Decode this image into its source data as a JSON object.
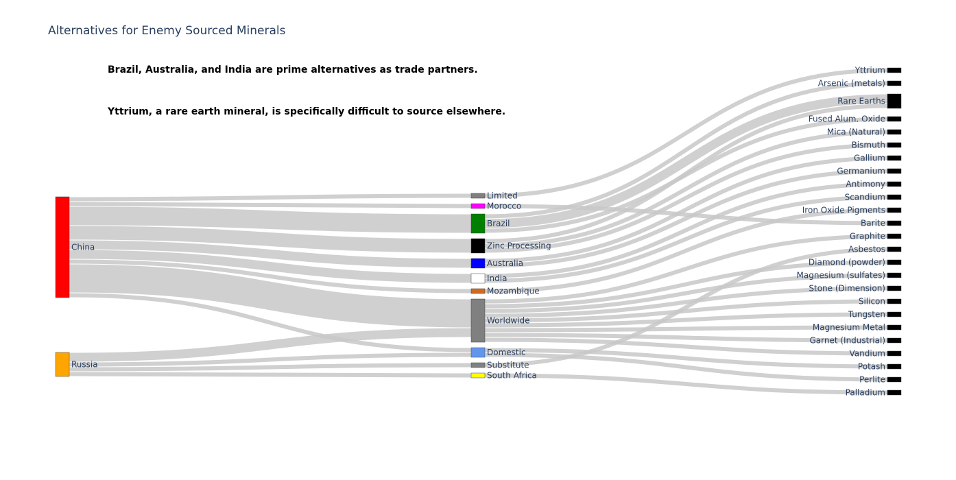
{
  "title": "Alternatives for Enemy Sourced Minerals",
  "annotations": [
    "Brazil, Australia, and India are prime alternatives as trade partners.",
    "Yttrium, a rare earth mineral, is specifically difficult to source elsewhere."
  ],
  "chart_data": {
    "type": "sankey",
    "title": "Alternatives for Enemy Sourced Minerals",
    "link_color": "#c8c8c8",
    "nodes": [
      {
        "id": "China",
        "label": "China",
        "column": 0,
        "color": "#ff0000"
      },
      {
        "id": "Russia",
        "label": "Russia",
        "column": 0,
        "color": "#ffa500"
      },
      {
        "id": "Limited",
        "label": "Limited",
        "column": 1,
        "color": "#808080"
      },
      {
        "id": "Morocco",
        "label": "Morocco",
        "column": 1,
        "color": "#ff00ff"
      },
      {
        "id": "Brazil",
        "label": "Brazil",
        "column": 1,
        "color": "#008000"
      },
      {
        "id": "Zinc Processing",
        "label": "Zinc Processing",
        "column": 1,
        "color": "#000000"
      },
      {
        "id": "Australia",
        "label": "Australia",
        "column": 1,
        "color": "#0000ff"
      },
      {
        "id": "India",
        "label": "India",
        "column": 1,
        "color": "#ffffff"
      },
      {
        "id": "Mozambique",
        "label": "Mozambique",
        "column": 1,
        "color": "#d2691e"
      },
      {
        "id": "Worldwide",
        "label": "Worldwide",
        "column": 1,
        "color": "#808080"
      },
      {
        "id": "Domestic",
        "label": "Domestic",
        "column": 1,
        "color": "#6495ed"
      },
      {
        "id": "Substitute",
        "label": "Substitute",
        "column": 1,
        "color": "#808080"
      },
      {
        "id": "South Africa",
        "label": "South Africa",
        "column": 1,
        "color": "#ffff00"
      },
      {
        "id": "Yttrium",
        "label": "Yttrium",
        "column": 2,
        "color": "#000000"
      },
      {
        "id": "Arsenic (metals)",
        "label": "Arsenic (metals)",
        "column": 2,
        "color": "#000000"
      },
      {
        "id": "Rare Earths",
        "label": "Rare Earths",
        "column": 2,
        "color": "#000000"
      },
      {
        "id": "Fused Alum. Oxide",
        "label": "Fused Alum. Oxide",
        "column": 2,
        "color": "#000000"
      },
      {
        "id": "Mica (Natural)",
        "label": "Mica (Natural)",
        "column": 2,
        "color": "#000000"
      },
      {
        "id": "Bismuth",
        "label": "Bismuth",
        "column": 2,
        "color": "#000000"
      },
      {
        "id": "Gallium",
        "label": "Gallium",
        "column": 2,
        "color": "#000000"
      },
      {
        "id": "Germanium",
        "label": "Germanium",
        "column": 2,
        "color": "#000000"
      },
      {
        "id": "Antimony",
        "label": "Antimony",
        "column": 2,
        "color": "#000000"
      },
      {
        "id": "Scandium",
        "label": "Scandium",
        "column": 2,
        "color": "#000000"
      },
      {
        "id": "Iron Oxide Pigments",
        "label": "Iron Oxide Pigments",
        "column": 2,
        "color": "#000000"
      },
      {
        "id": "Barite",
        "label": "Barite",
        "column": 2,
        "color": "#000000"
      },
      {
        "id": "Graphite",
        "label": "Graphite",
        "column": 2,
        "color": "#000000"
      },
      {
        "id": "Asbestos",
        "label": "Asbestos",
        "column": 2,
        "color": "#000000"
      },
      {
        "id": "Diamond (powder)",
        "label": "Diamond (powder)",
        "column": 2,
        "color": "#000000"
      },
      {
        "id": "Magnesium (sulfates)",
        "label": "Magnesium (sulfates)",
        "column": 2,
        "color": "#000000"
      },
      {
        "id": "Stone (Dimension)",
        "label": "Stone (Dimension)",
        "column": 2,
        "color": "#000000"
      },
      {
        "id": "Silicon",
        "label": "Silicon",
        "column": 2,
        "color": "#000000"
      },
      {
        "id": "Tungsten",
        "label": "Tungsten",
        "column": 2,
        "color": "#000000"
      },
      {
        "id": "Magnesium Metal",
        "label": "Magnesium Metal",
        "column": 2,
        "color": "#000000"
      },
      {
        "id": "Garnet (Industrial)",
        "label": "Garnet (Industrial)",
        "column": 2,
        "color": "#000000"
      },
      {
        "id": "Vandium",
        "label": "Vandium",
        "column": 2,
        "color": "#000000"
      },
      {
        "id": "Potash",
        "label": "Potash",
        "column": 2,
        "color": "#000000"
      },
      {
        "id": "Perlite",
        "label": "Perlite",
        "column": 2,
        "color": "#000000"
      },
      {
        "id": "Palladium",
        "label": "Palladium",
        "column": 2,
        "color": "#000000"
      }
    ],
    "links": [
      {
        "source": "China",
        "target": "Limited",
        "value": 1
      },
      {
        "source": "China",
        "target": "Morocco",
        "value": 1
      },
      {
        "source": "China",
        "target": "Brazil",
        "value": 4
      },
      {
        "source": "China",
        "target": "Zinc Processing",
        "value": 3
      },
      {
        "source": "China",
        "target": "Australia",
        "value": 2
      },
      {
        "source": "China",
        "target": "India",
        "value": 2
      },
      {
        "source": "China",
        "target": "Mozambique",
        "value": 1
      },
      {
        "source": "China",
        "target": "Worldwide",
        "value": 6
      },
      {
        "source": "China",
        "target": "Domestic",
        "value": 1
      },
      {
        "source": "Russia",
        "target": "Worldwide",
        "value": 2
      },
      {
        "source": "Russia",
        "target": "Domestic",
        "value": 1
      },
      {
        "source": "Russia",
        "target": "Substitute",
        "value": 1
      },
      {
        "source": "Russia",
        "target": "South Africa",
        "value": 1
      },
      {
        "source": "Limited",
        "target": "Yttrium",
        "value": 1
      },
      {
        "source": "Brazil",
        "target": "Arsenic (metals)",
        "value": 1
      },
      {
        "source": "Brazil",
        "target": "Rare Earths",
        "value": 2
      },
      {
        "source": "Zinc Processing",
        "target": "Rare Earths",
        "value": 1
      },
      {
        "source": "Brazil",
        "target": "Fused Alum. Oxide",
        "value": 1
      },
      {
        "source": "Zinc Processing",
        "target": "Mica (Natural)",
        "value": 1
      },
      {
        "source": "Zinc Processing",
        "target": "Bismuth",
        "value": 1
      },
      {
        "source": "Australia",
        "target": "Gallium",
        "value": 1
      },
      {
        "source": "Australia",
        "target": "Germanium",
        "value": 1
      },
      {
        "source": "India",
        "target": "Antimony",
        "value": 1
      },
      {
        "source": "India",
        "target": "Scandium",
        "value": 1
      },
      {
        "source": "Mozambique",
        "target": "Iron Oxide Pigments",
        "value": 1
      },
      {
        "source": "Morocco",
        "target": "Barite",
        "value": 1
      },
      {
        "source": "Worldwide",
        "target": "Graphite",
        "value": 1
      },
      {
        "source": "Substitute",
        "target": "Asbestos",
        "value": 1
      },
      {
        "source": "Worldwide",
        "target": "Diamond (powder)",
        "value": 1
      },
      {
        "source": "Worldwide",
        "target": "Magnesium (sulfates)",
        "value": 1
      },
      {
        "source": "Worldwide",
        "target": "Stone (Dimension)",
        "value": 1
      },
      {
        "source": "Worldwide",
        "target": "Silicon",
        "value": 1
      },
      {
        "source": "Worldwide",
        "target": "Tungsten",
        "value": 1
      },
      {
        "source": "Worldwide",
        "target": "Magnesium Metal",
        "value": 1
      },
      {
        "source": "Worldwide",
        "target": "Garnet (Industrial)",
        "value": 1
      },
      {
        "source": "Worldwide",
        "target": "Vandium",
        "value": 1
      },
      {
        "source": "Domestic",
        "target": "Potash",
        "value": 1
      },
      {
        "source": "Domestic",
        "target": "Perlite",
        "value": 1
      },
      {
        "source": "South Africa",
        "target": "Palladium",
        "value": 1
      }
    ]
  }
}
